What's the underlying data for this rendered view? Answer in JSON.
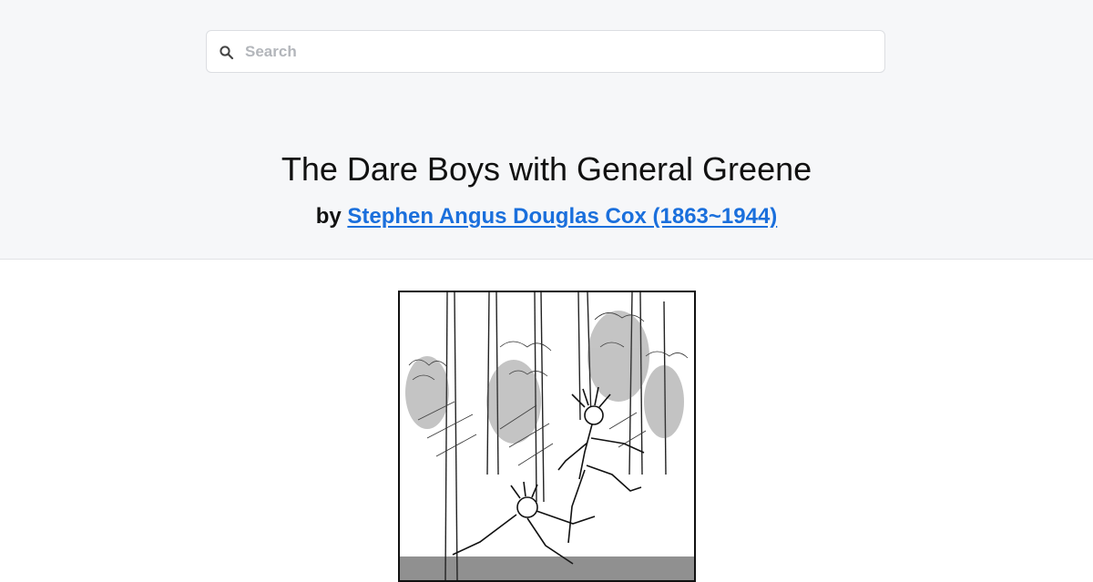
{
  "search": {
    "placeholder": "Search",
    "icon": "search-icon"
  },
  "book": {
    "title": "The Dare Boys with General Greene",
    "by_prefix": "by",
    "author": "Stephen Angus Douglas Cox (1863~1944)"
  },
  "colors": {
    "header_bg": "#f6f7f9",
    "link": "#1a6fdc"
  }
}
